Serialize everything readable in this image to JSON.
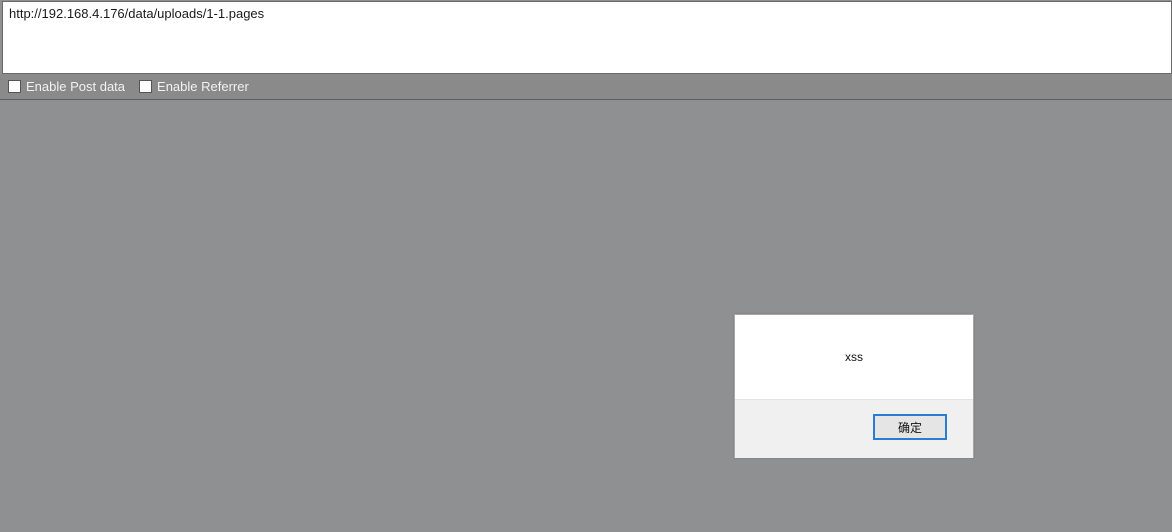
{
  "address_bar": {
    "url": "http://192.168.4.176/data/uploads/1-1.pages"
  },
  "options": {
    "post_data_label": "Enable Post data",
    "post_data_checked": false,
    "referrer_label": "Enable Referrer",
    "referrer_checked": false
  },
  "alert_dialog": {
    "message": "xss",
    "ok_label": "确定"
  },
  "colors": {
    "page_overlay": "#8f9092",
    "ok_button_border": "#2a7bd4"
  }
}
